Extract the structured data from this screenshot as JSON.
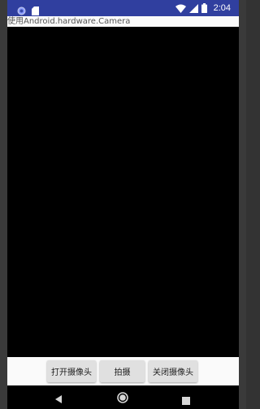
{
  "status_bar": {
    "time": "2:04",
    "background": "#303f9f",
    "left_icons": [
      "sync-icon",
      "sd-card-icon"
    ],
    "right_icons": [
      "wifi-icon",
      "signal-icon",
      "battery-icon"
    ]
  },
  "app": {
    "title": "使用Android.hardware.Camera"
  },
  "buttons": {
    "open_camera": "打开摄像头",
    "capture": "拍摄",
    "close_camera": "关闭摄像头"
  },
  "nav_bar": {
    "icons": [
      "back-icon",
      "home-icon",
      "recents-icon"
    ]
  }
}
